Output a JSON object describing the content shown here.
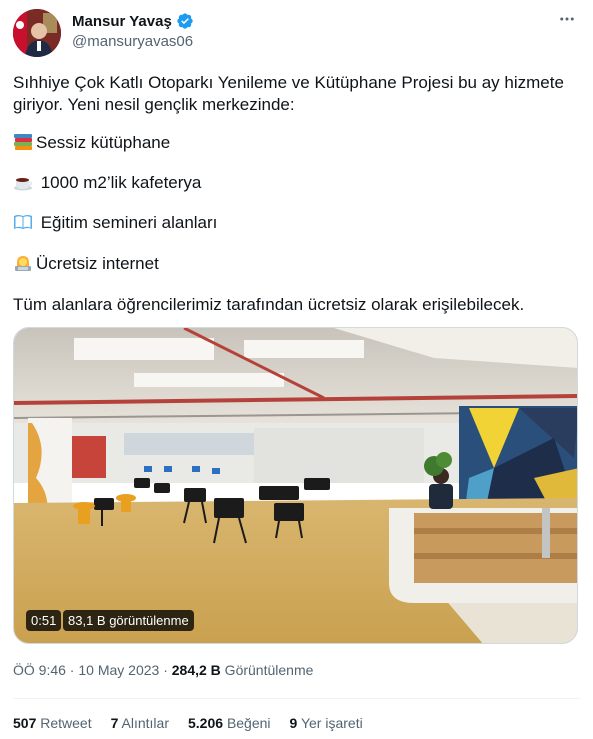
{
  "author": {
    "name": "Mansur Yavaş",
    "handle": "@mansuryavas06",
    "verified": true,
    "verified_color": "#1d9bf0"
  },
  "more_icon": "more-dots-icon",
  "tweet": {
    "intro_line1": "Sıhhiye Çok Katlı Otoparkı Yenileme ve Kütüphane Projesi bu ay hizmete",
    "intro_line2": "giriyor. Yeni nesil gençlik merkezinde:",
    "features": [
      {
        "icon": "books-emoji",
        "text": "Sessiz kütüphane"
      },
      {
        "icon": "coffee-emoji",
        "text": " 1000 m2’lik kafeterya"
      },
      {
        "icon": "open-book-emoji",
        "text": " Eğitim semineri alanları"
      },
      {
        "icon": "technologist-emoji",
        "text": "Ücretsiz internet"
      }
    ],
    "closing": "Tüm alanlara öğrencilerimiz tarafından ücretsiz olarak erişilebilecek."
  },
  "video": {
    "duration": "0:51",
    "views": "83,1 B görüntülenme"
  },
  "meta": {
    "time_date": "ÖÖ 9:46 · 10 May 2023 · ",
    "views_count": "284,2 B",
    "views_label": " Görüntülenme"
  },
  "stats": {
    "retweets_count": "507",
    "retweets_label": "Retweet",
    "quotes_count": "7",
    "quotes_label": "Alıntılar",
    "likes_count": "5.206",
    "likes_label": "Beğeni",
    "bookmarks_count": "9",
    "bookmarks_label": "Yer işareti"
  }
}
